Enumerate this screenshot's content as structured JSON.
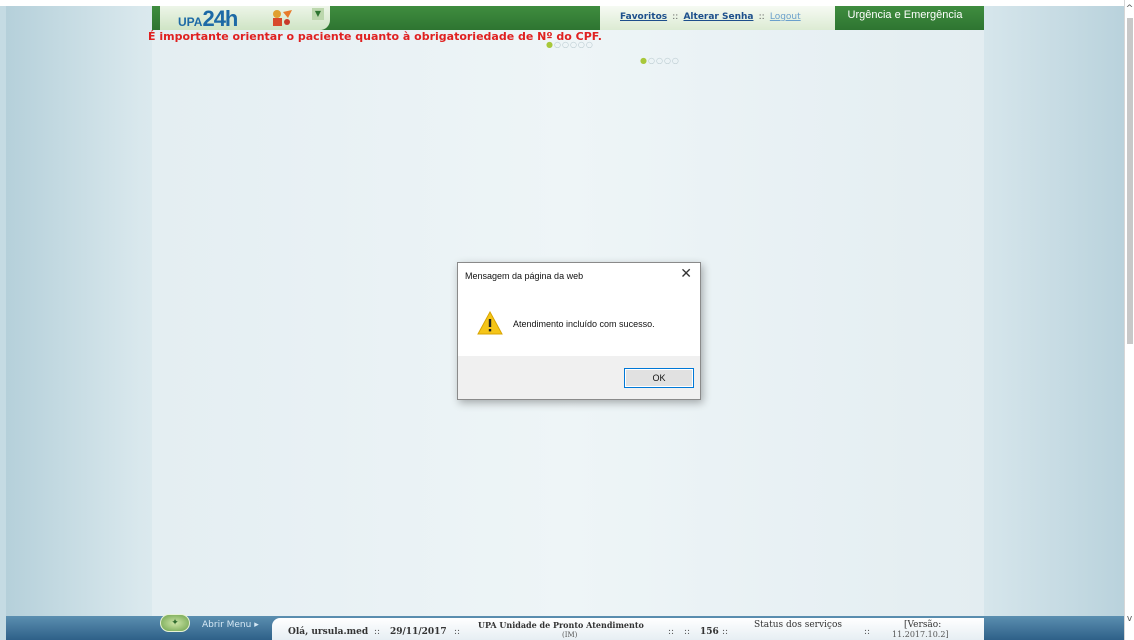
{
  "header": {
    "logo_prefix": "UPA",
    "logo_main": "24h",
    "links": {
      "favorites": "Favoritos",
      "change_password": "Alterar Senha",
      "logout": "Logout",
      "separator": "::"
    },
    "section": "Urgência e Emergência"
  },
  "warning": "É importante orientar o paciente quanto à obrigatoriedade de Nº do CPF.",
  "dialog": {
    "title": "Mensagem da página da web",
    "close_glyph": "✕",
    "message": "Atendimento incluído com sucesso.",
    "ok_label": "OK"
  },
  "footer": {
    "menu_label": "Abrir Menu",
    "greeting": "Olá, ursula.med",
    "date": "29/11/2017",
    "unit": "UPA Unidade de Pronto Atendimento",
    "unit_extra": "(IM)",
    "separator": "::",
    "number": "156",
    "services": "Status dos serviços",
    "version_label": "[Versão:",
    "version_value": "11.2017.10.2]"
  },
  "colors": {
    "header_green": "#2e7531",
    "warning_red": "#e02020",
    "footer_blue": "#2e6088",
    "dialog_accent": "#0078d7"
  }
}
